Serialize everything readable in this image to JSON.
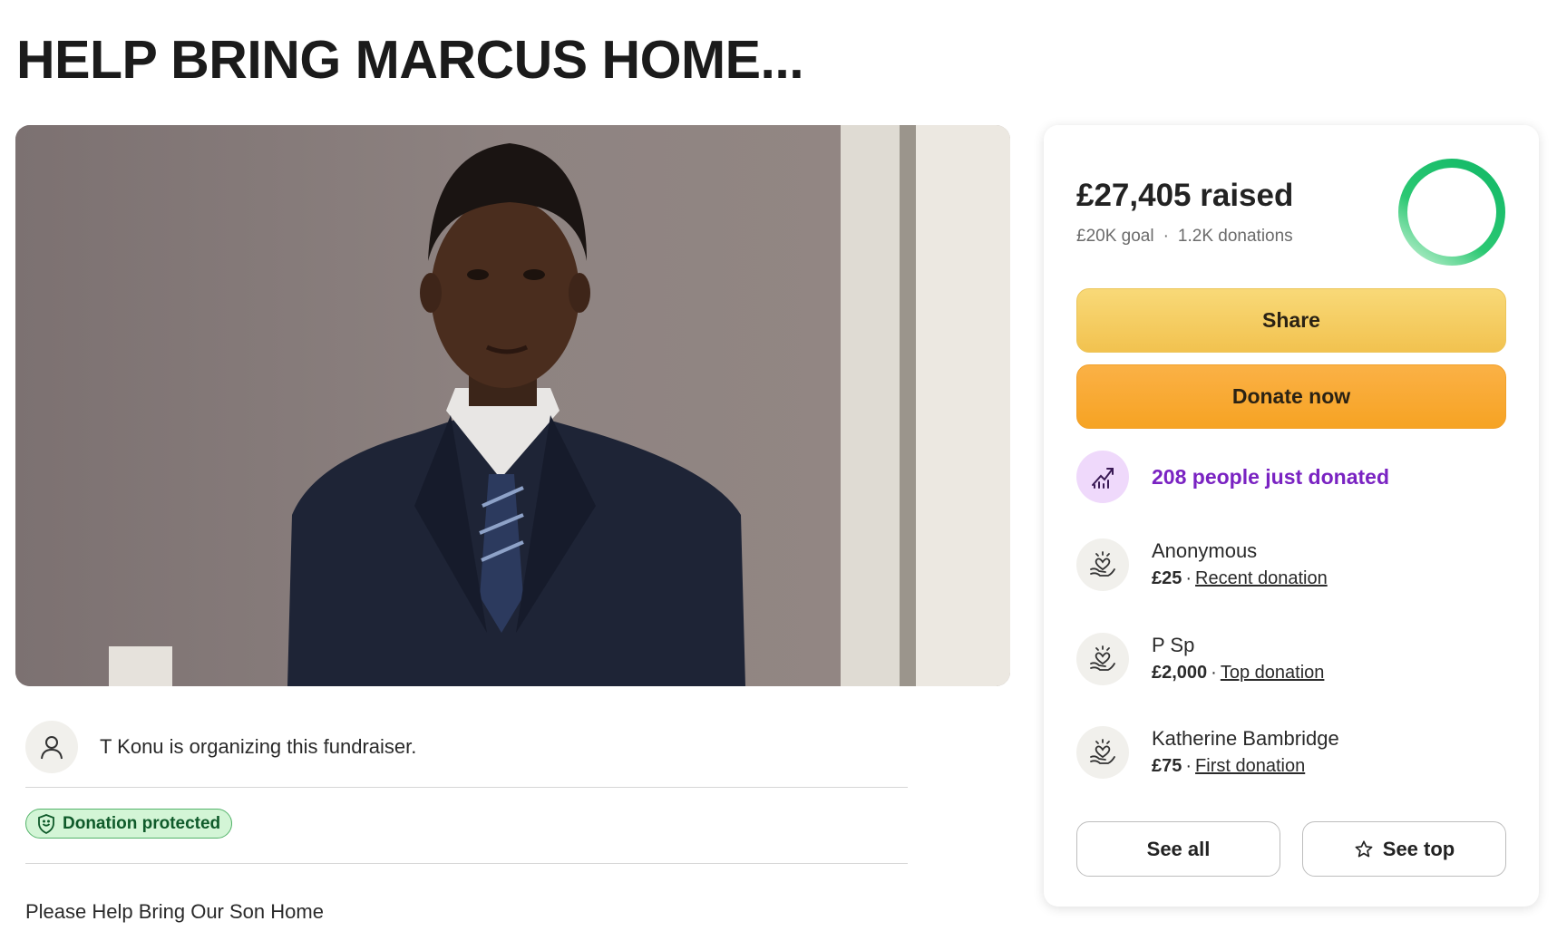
{
  "page": {
    "title": "HELP BRING MARCUS HOME...",
    "hero_image_alt": "Portrait of Marcus in a dark suit and tie"
  },
  "organizer": {
    "text": "T Konu is organizing this fundraiser.",
    "icon": "person-icon"
  },
  "badge": {
    "label": "Donation protected",
    "icon": "shield-icon"
  },
  "story": {
    "first_line": "Please Help Bring Our Son Home"
  },
  "panel": {
    "raised": "£27,405 raised",
    "goal": "£20K goal",
    "donations": "1.2K donations",
    "progress_fraction": 1.0,
    "share_label": "Share",
    "donate_label": "Donate now",
    "trend_text": "208 people just donated",
    "donors": [
      {
        "name": "Anonymous",
        "amount": "£25",
        "tag": "Recent donation"
      },
      {
        "name": "P Sp",
        "amount": "£2,000",
        "tag": "Top donation"
      },
      {
        "name": "Katherine Bambridge",
        "amount": "£75",
        "tag": "First donation"
      }
    ],
    "see_all_label": "See all",
    "see_top_label": "See top"
  },
  "colors": {
    "share": "#f2c24f",
    "donate": "#f6a323",
    "trend": "#7a23c2",
    "progress": "#1ebd6a",
    "badge_bg": "#d3f5d6"
  }
}
